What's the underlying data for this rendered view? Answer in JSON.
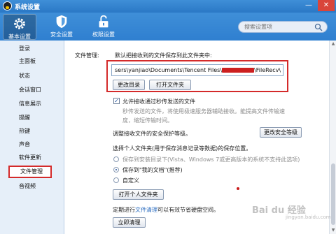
{
  "window": {
    "title": "系统设置",
    "minimize": "—",
    "close": "✕"
  },
  "toolbar": {
    "items": [
      {
        "label": "基本设置",
        "icon": "gear-icon",
        "active": true
      },
      {
        "label": "安全设置",
        "icon": "shield-icon",
        "active": false
      },
      {
        "label": "权限设置",
        "icon": "lock-icon",
        "active": false
      }
    ],
    "search_placeholder": "搜索设置项"
  },
  "sidebar": {
    "items": [
      {
        "label": "登录"
      },
      {
        "label": "主面板"
      },
      {
        "label": "状态"
      },
      {
        "label": "会话窗口"
      },
      {
        "label": "信息展示"
      },
      {
        "label": "提醒"
      },
      {
        "label": "热键"
      },
      {
        "label": "声音"
      },
      {
        "label": "软件更新"
      },
      {
        "label": "文件管理",
        "active": true
      },
      {
        "label": "音视频"
      }
    ]
  },
  "file_mgmt": {
    "section_label": "文件管理:",
    "save_desc": "默认把接收到的文件保存到此文件夹中:",
    "path_prefix": "sers\\yanjiao\\Documents\\Tencent Files\\",
    "path_suffix": "\\FileRecv\\",
    "change_dir": "更改目录",
    "open_folder": "打开文件夹",
    "allow_offline": "允许接收通过秒传发送的文件",
    "allow_offline_checked": true,
    "offline_desc_1": "秒传发送的文件，将使用极速服务器辅助接收。能提高文件传输速",
    "offline_desc_2": "度，缩短传输时间。",
    "security_level": "调整接收文件的安全保护等级。",
    "change_security": "更改安全等级",
    "personal_folder": "选择个人文件夹(用于保存消息记录等数据)的保存位置。",
    "opt_install": "保存到安装目录下(Vista、Windows 7或更高版本的系统不支持此选项)",
    "opt_mydocs": "保存到\"我的文档\"(推荐)",
    "opt_custom": "自定义",
    "open_personal": "打开个人文件夹",
    "cleanup_prefix": "定期进行",
    "cleanup_link": "文件清理",
    "cleanup_suffix": "可以有效节省硬盘空间。",
    "cleanup_now": "立即清理"
  },
  "watermark": {
    "text": "Bai du 经验",
    "sub": "jingyan.baidu.com"
  },
  "colors": {
    "title_bar": "#2a78c6",
    "highlight_border": "#d42a2a",
    "sidebar_bg": "#e6eff9"
  }
}
